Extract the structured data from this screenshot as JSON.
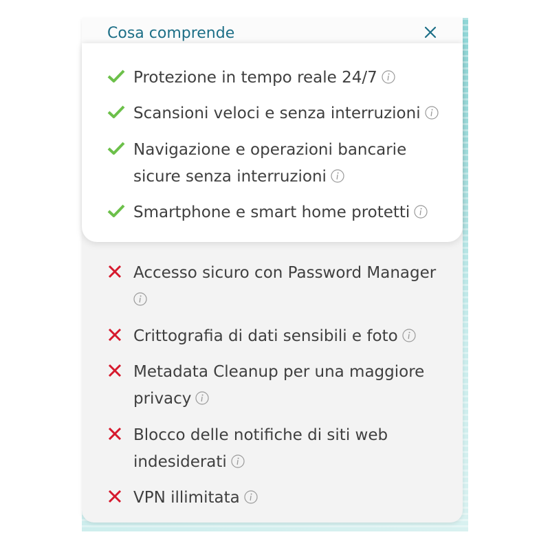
{
  "panel": {
    "title": "Cosa comprende",
    "close_icon": "close-icon",
    "colors": {
      "title": "#1d6f87",
      "check": "#6cc04a",
      "cross": "#d6192d",
      "info": "#9a9a9a"
    }
  },
  "included": [
    {
      "label": "Protezione in tempo reale 24/7",
      "status": "included",
      "icon": "check-icon"
    },
    {
      "label": "Scansioni veloci e senza interruzioni",
      "status": "included",
      "icon": "check-icon"
    },
    {
      "label": "Navigazione e operazioni bancarie sicure senza interruzioni",
      "status": "included",
      "icon": "check-icon"
    },
    {
      "label": "Smartphone e smart home protetti",
      "status": "included",
      "icon": "check-icon"
    }
  ],
  "excluded": [
    {
      "label": "Accesso sicuro con Password Manager",
      "status": "excluded",
      "icon": "cross-icon"
    },
    {
      "label": "Crittografia di dati sensibili e foto",
      "status": "excluded",
      "icon": "cross-icon"
    },
    {
      "label": "Metadata Cleanup per una maggiore privacy",
      "status": "excluded",
      "icon": "cross-icon"
    },
    {
      "label": "Blocco delle notifiche di siti web indesiderati",
      "status": "excluded",
      "icon": "cross-icon"
    },
    {
      "label": "VPN illimitata",
      "status": "excluded",
      "icon": "cross-icon"
    }
  ]
}
